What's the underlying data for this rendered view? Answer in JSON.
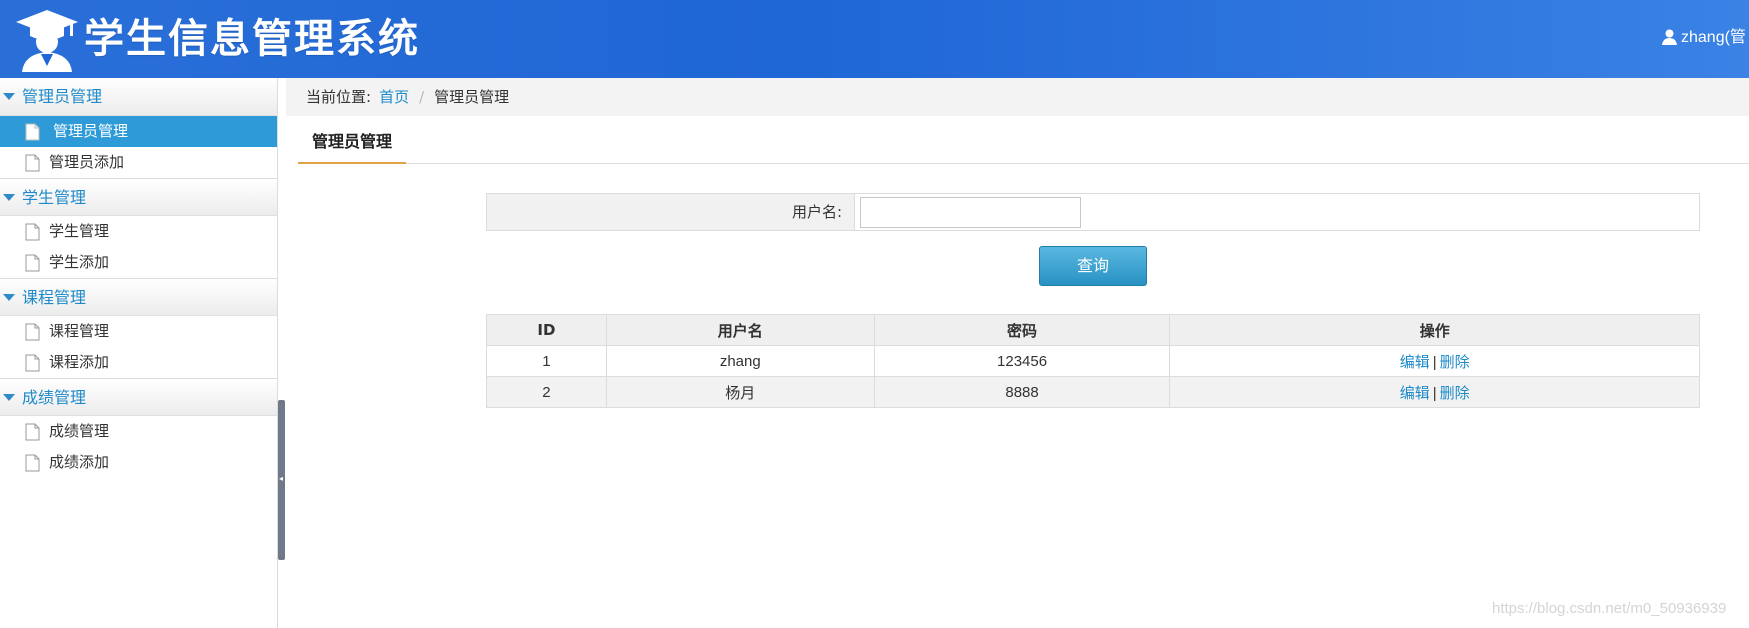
{
  "header": {
    "title": "学生信息管理系统",
    "user": "zhang(管"
  },
  "sidebar": {
    "groups": [
      {
        "title": "管理员管理",
        "items": [
          {
            "label": "管理员管理",
            "active": true
          },
          {
            "label": "管理员添加"
          }
        ]
      },
      {
        "title": "学生管理",
        "items": [
          {
            "label": "学生管理"
          },
          {
            "label": "学生添加"
          }
        ]
      },
      {
        "title": "课程管理",
        "items": [
          {
            "label": "课程管理"
          },
          {
            "label": "课程添加"
          }
        ]
      },
      {
        "title": "成绩管理",
        "items": [
          {
            "label": "成绩管理"
          },
          {
            "label": "成绩添加"
          }
        ]
      }
    ]
  },
  "breadcrumb": {
    "prefix": "当前位置:",
    "home": "首页",
    "separator": "/",
    "current": "管理员管理"
  },
  "tab": {
    "label": "管理员管理"
  },
  "search": {
    "label": "用户名:",
    "value": "",
    "button": "查询"
  },
  "table": {
    "headers": [
      "ID",
      "用户名",
      "密码",
      "操作"
    ],
    "rows": [
      {
        "id": "1",
        "username": "zhang",
        "password": "123456",
        "edit": "编辑",
        "delete": "删除"
      },
      {
        "id": "2",
        "username": "杨月",
        "password": "8888",
        "edit": "编辑",
        "delete": "删除"
      }
    ],
    "pipe": "|"
  },
  "watermark": "https://blog.csdn.net/m0_50936939",
  "colors": {
    "header": "#2a6fd8",
    "accent": "#1e8ac9",
    "active": "#2e9bd8",
    "tab_underline": "#e0a446"
  }
}
